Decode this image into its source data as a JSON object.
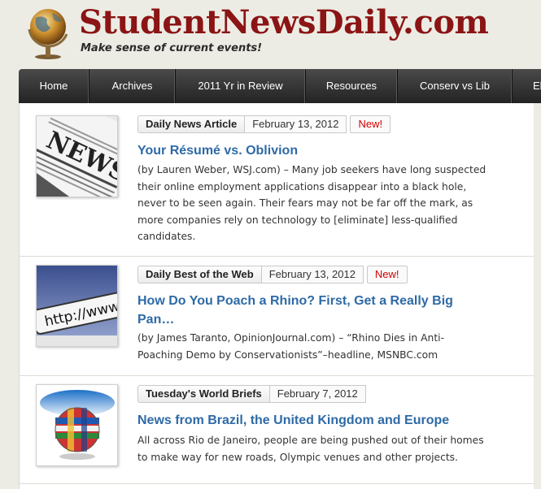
{
  "site": {
    "title": "StudentNewsDaily.com",
    "tagline": "Make sense of current events!"
  },
  "nav": {
    "items": [
      {
        "label": "Home"
      },
      {
        "label": "Archives"
      },
      {
        "label": "2011 Yr in Review"
      },
      {
        "label": "Resources"
      },
      {
        "label": "Conserv vs Lib"
      },
      {
        "label": "El"
      }
    ]
  },
  "articles": [
    {
      "category": "Daily News Article",
      "date": "February 13, 2012",
      "badge": "New!",
      "title": "Your Résumé vs. Oblivion",
      "summary": "(by Lauren Weber, WSJ.com) – Many job seekers have long suspected their online employment applications disappear into a black hole, never to be seen again. Their fears may not be far off the mark, as more companies rely on technology to [eliminate] less-qualified candidates.",
      "thumb_text": "NEWS"
    },
    {
      "category": "Daily Best of the Web",
      "date": "February 13, 2012",
      "badge": "New!",
      "title": "How Do You Poach a Rhino? First, Get a Really Big Pan…",
      "summary": "(by James Taranto, OpinionJournal.com) – “Rhino Dies in Anti-Poaching Demo by Conservationists”–headline, MSNBC.com",
      "thumb_text": "http://www."
    },
    {
      "category": "Tuesday's World Briefs",
      "date": "February 7, 2012",
      "badge": "",
      "title": "News from Brazil, the United Kingdom and Europe",
      "summary": "All across Rio de Janeiro, people are being pushed out of their homes to make way for new roads, Olympic venues and other projects.",
      "thumb_text": ""
    }
  ],
  "colors": {
    "brand": "#8b1414",
    "link": "#2e6aa6",
    "badge": "#d00000",
    "nav_bg": "#2f2f2f"
  }
}
